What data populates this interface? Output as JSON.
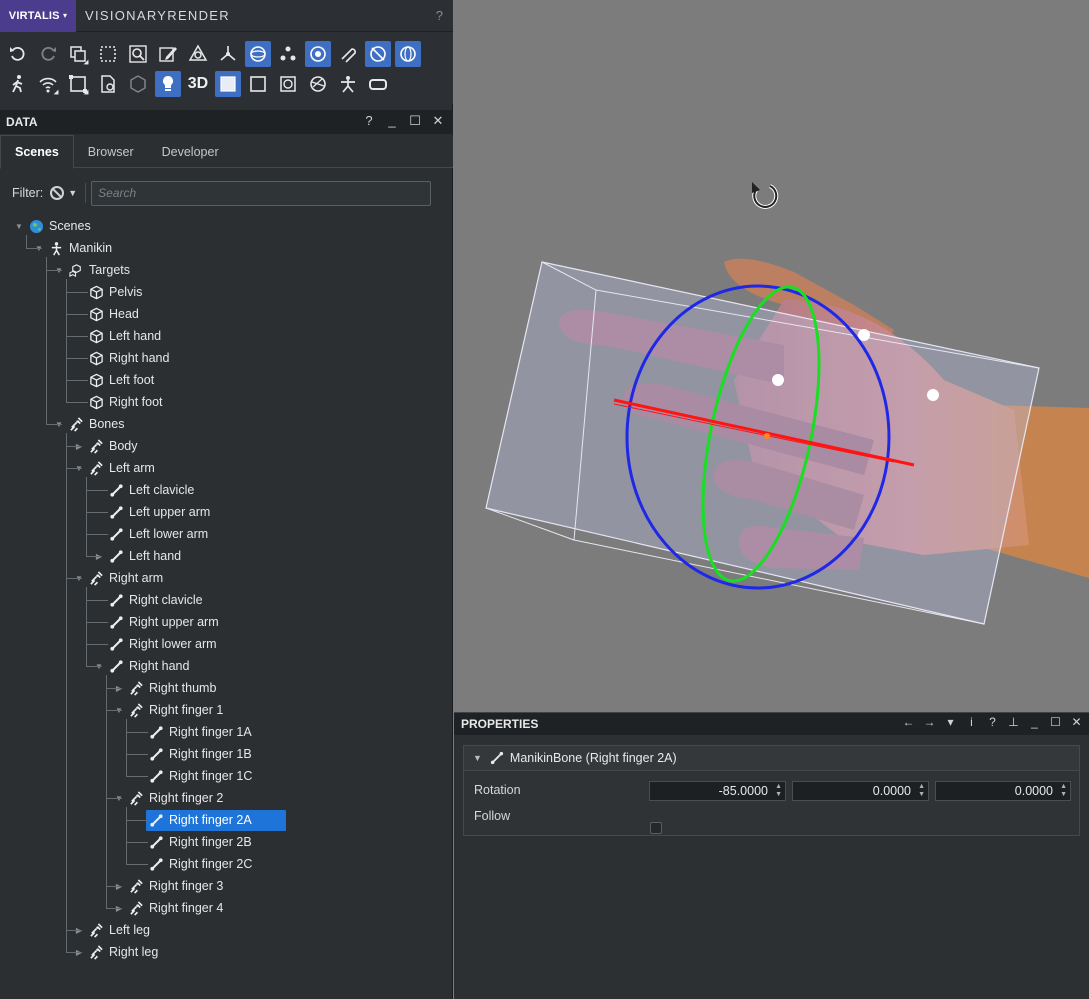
{
  "app": {
    "brand": "VIRTALIS",
    "title": "VISIONARYRENDER",
    "help": "?"
  },
  "data_panel": {
    "title": "DATA",
    "header_icons": [
      "?",
      "_",
      "☐",
      "✕"
    ],
    "tabs": [
      "Scenes",
      "Browser",
      "Developer"
    ],
    "active_tab": "Scenes",
    "filter_label": "Filter:",
    "search_placeholder": "Search"
  },
  "tree": [
    {
      "label": "Scenes",
      "icon": "globe-icon"
    },
    {
      "label": "Manikin",
      "icon": "figure-icon"
    },
    {
      "label": "Targets",
      "icon": "targets-icon"
    },
    {
      "label": "Pelvis",
      "icon": "cube-icon"
    },
    {
      "label": "Head",
      "icon": "cube-icon"
    },
    {
      "label": "Left hand",
      "icon": "cube-icon"
    },
    {
      "label": "Right hand",
      "icon": "cube-icon"
    },
    {
      "label": "Left foot",
      "icon": "cube-icon"
    },
    {
      "label": "Right foot",
      "icon": "cube-icon"
    },
    {
      "label": "Bones",
      "icon": "bones-icon"
    },
    {
      "label": "Body",
      "icon": "bones-icon"
    },
    {
      "label": "Left arm",
      "icon": "bones-icon"
    },
    {
      "label": "Left clavicle",
      "icon": "bone-icon"
    },
    {
      "label": "Left upper arm",
      "icon": "bone-icon"
    },
    {
      "label": "Left lower arm",
      "icon": "bone-icon"
    },
    {
      "label": "Left hand",
      "icon": "bone-icon"
    },
    {
      "label": "Right arm",
      "icon": "bones-icon"
    },
    {
      "label": "Right clavicle",
      "icon": "bone-icon"
    },
    {
      "label": "Right upper arm",
      "icon": "bone-icon"
    },
    {
      "label": "Right lower arm",
      "icon": "bone-icon"
    },
    {
      "label": "Right hand",
      "icon": "bone-icon"
    },
    {
      "label": "Right thumb",
      "icon": "bones-icon"
    },
    {
      "label": "Right finger 1",
      "icon": "bones-icon"
    },
    {
      "label": "Right finger 1A",
      "icon": "bone-icon"
    },
    {
      "label": "Right finger 1B",
      "icon": "bone-icon"
    },
    {
      "label": "Right finger 1C",
      "icon": "bone-icon"
    },
    {
      "label": "Right finger 2",
      "icon": "bones-icon"
    },
    {
      "label": "Right finger 2A",
      "icon": "bone-icon",
      "selected": true
    },
    {
      "label": "Right finger 2B",
      "icon": "bone-icon"
    },
    {
      "label": "Right finger 2C",
      "icon": "bone-icon"
    },
    {
      "label": "Right finger 3",
      "icon": "bones-icon"
    },
    {
      "label": "Right finger 4",
      "icon": "bones-icon"
    },
    {
      "label": "Left leg",
      "icon": "bones-icon"
    },
    {
      "label": "Right leg",
      "icon": "bones-icon"
    }
  ],
  "toolbar": {
    "three_d_label": "3D",
    "row1": [
      "undo-icon",
      "redo-icon",
      "copy-icon",
      "select-box-icon",
      "zoom-fit-icon",
      "edit-icon",
      "physics-icon",
      "axes-icon",
      "sphere-icon",
      "nodes-icon",
      "orbit-icon",
      "attach-icon",
      "collision-icon",
      "rotate-gizmo-icon"
    ],
    "row2": [
      "walk-icon",
      "wifi-icon",
      "frame-icon",
      "document-icon",
      "box-icon",
      "light-icon",
      "3d-icon",
      "fill-icon",
      "outline-icon",
      "texture-icon",
      "shader-icon",
      "manikin-icon",
      "vr-icon"
    ]
  },
  "properties": {
    "title": "PROPERTIES",
    "header_icons": [
      "←",
      "→",
      "▾",
      "i",
      "?",
      "⊥",
      "_",
      "☐",
      "✕"
    ],
    "bone_title": "ManikinBone (Right finger 2A)",
    "rotation_label": "Rotation",
    "rotation_values": [
      "-85.0000",
      "0.0000",
      "0.0000"
    ],
    "follow_label": "Follow",
    "follow_checked": false
  },
  "colors": {
    "selection": "#1e74d8",
    "brand": "#4c3c8e",
    "toolbar_active": "#3f6fc2"
  }
}
